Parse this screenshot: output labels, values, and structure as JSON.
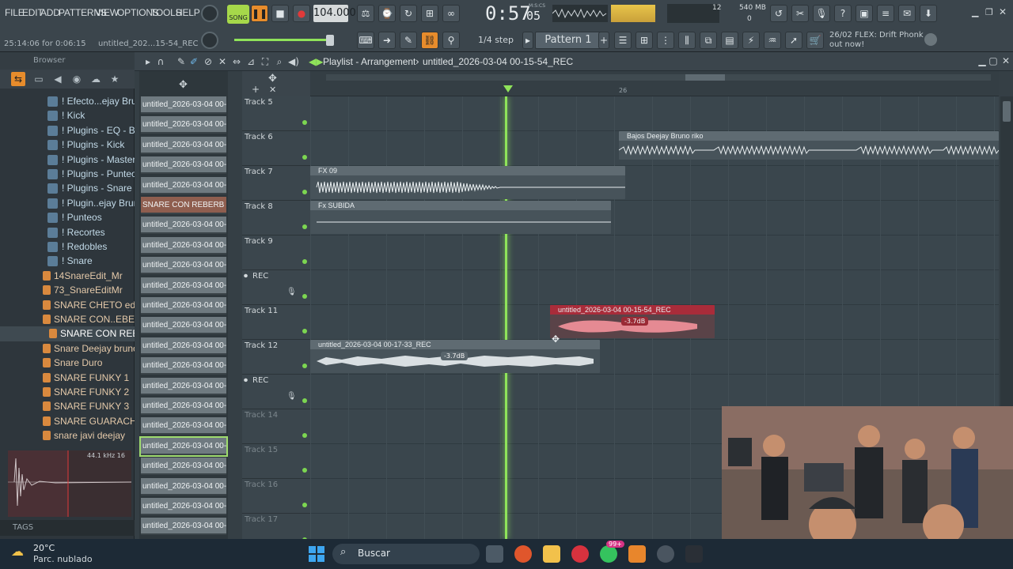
{
  "menu": [
    "FILE",
    "EDIT",
    "ADD",
    "PATTERNS",
    "VIEW",
    "OPTIONS",
    "TOOLS",
    "HELP"
  ],
  "hint": {
    "time": "25:14:06 for 0:06:15",
    "project": "untitled_202...15-54_REC"
  },
  "transport": {
    "mode": "SONG",
    "tempo": "104.000",
    "time": "0:57",
    "time_sub": "05",
    "mcs": "M:S:CS"
  },
  "meters": {
    "cpu": "12",
    "mem": "540 MB",
    "poly": "0"
  },
  "snap": "1/4 step",
  "pattern": "Pattern 1",
  "news": {
    "date": "26/02",
    "title": "FLEX: Drift Phonk",
    "sub": "out now!"
  },
  "browser": {
    "title": "Browser",
    "tree": [
      {
        "label": "! Efecto...ejay Bruno",
        "type": "folder"
      },
      {
        "label": "! Kick",
        "type": "folder"
      },
      {
        "label": "! Plugins - EQ - Bajo",
        "type": "folder"
      },
      {
        "label": "! Plugins - Kick",
        "type": "folder"
      },
      {
        "label": "! Plugins - Master",
        "type": "folder"
      },
      {
        "label": "! Plugins - Punteo",
        "type": "folder"
      },
      {
        "label": "! Plugins - Snare",
        "type": "folder"
      },
      {
        "label": "! Plugin..ejay Bruno",
        "type": "folder"
      },
      {
        "label": "! Punteos",
        "type": "folder"
      },
      {
        "label": "! Recortes",
        "type": "folder"
      },
      {
        "label": "! Redobles",
        "type": "folder"
      },
      {
        "label": "! Snare",
        "type": "folder"
      },
      {
        "label": "14SnareEdit_Mr",
        "type": "file"
      },
      {
        "label": "73_SnareEditMr",
        "type": "file"
      },
      {
        "label": "SNARE CHETO edit_Mr",
        "type": "file"
      },
      {
        "label": "SNARE CON..EBERB 2.0",
        "type": "file"
      },
      {
        "label": "SNARE CON REBERB",
        "type": "file"
      },
      {
        "label": "Snare Deejay bruno",
        "type": "file"
      },
      {
        "label": "Snare Duro",
        "type": "file"
      },
      {
        "label": "SNARE FUNKY 1",
        "type": "file"
      },
      {
        "label": "SNARE FUNKY 2",
        "type": "file"
      },
      {
        "label": "SNARE FUNKY 3",
        "type": "file"
      },
      {
        "label": "SNARE GUARACHA",
        "type": "file"
      },
      {
        "label": "snare javi deejay",
        "type": "file"
      }
    ],
    "sample_info": "44.1 kHz 16",
    "tags": "TAGS"
  },
  "playlist": {
    "title": "Playlist - Arrangement",
    "song": "untitled_2026-03-04 00-15-54_REC",
    "ruler_mark": "26",
    "patterns": [
      "untitled_2026-03-04 00-...",
      "untitled_2026-03-04 00-...",
      "untitled_2026-03-04 00-...",
      "untitled_2026-03-04 00-...",
      "untitled_2026-03-04 00-...",
      "SNARE CON REBERB",
      "untitled_2026-03-04 00-...",
      "untitled_2026-03-04 00-...",
      "untitled_2026-03-04 00-...",
      "untitled_2026-03-04 00-...",
      "untitled_2026-03-04 00-...",
      "untitled_2026-03-04 00-...",
      "untitled_2026-03-04 00-...",
      "untitled_2026-03-04 00-...",
      "untitled_2026-03-04 00-...",
      "untitled_2026-03-04 00-...",
      "untitled_2026-03-04 00-...",
      "untitled_2026-03-04 00-...",
      "untitled_2026-03-04 00-...",
      "untitled_2026-03-04 00-...",
      "untitled_2026-03-04 00-...",
      "untitled_2026-03-04 00-..."
    ],
    "tracks": [
      {
        "name": "Track 5"
      },
      {
        "name": "Track 6"
      },
      {
        "name": "Track 7"
      },
      {
        "name": "Track 8"
      },
      {
        "name": "Track 9"
      },
      {
        "name": "REC"
      },
      {
        "name": "Track 11"
      },
      {
        "name": "Track 12"
      },
      {
        "name": "REC"
      },
      {
        "name": "Track 14"
      },
      {
        "name": "Track 15"
      },
      {
        "name": "Track 16"
      },
      {
        "name": "Track 17"
      }
    ],
    "clips": [
      {
        "label": "Bajos Deejay Bruno riko"
      },
      {
        "label": "FX 09"
      },
      {
        "label": "Fx SUBIDA"
      },
      {
        "label": "untitled_2026-03-04 00-15-54_REC",
        "vol": "-3.7dB"
      },
      {
        "label": "untitled_2026-03-04 00-17-33_REC",
        "vol": "-3.7dB"
      }
    ]
  },
  "taskbar": {
    "temp": "20°C",
    "weather": "Parc. nublado",
    "search": "Buscar",
    "badge": "99+"
  },
  "colors": {
    "accent": "#e78c2c",
    "playhead": "#8fe35a",
    "rec_clip": "#a92c3a"
  }
}
